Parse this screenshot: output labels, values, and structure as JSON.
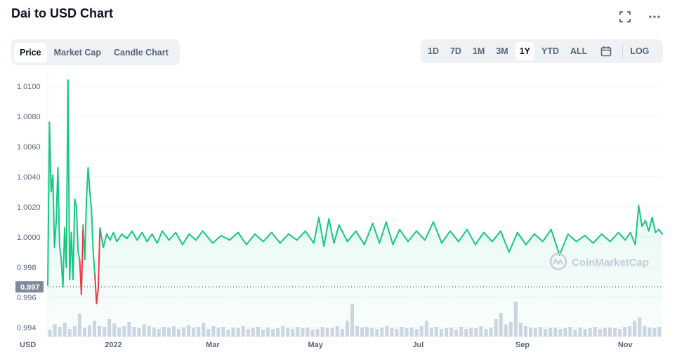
{
  "header": {
    "title": "Dai to USD Chart"
  },
  "icons": {
    "fullscreen": "fullscreen-icon",
    "more": "more-options-icon",
    "calendar": "calendar-icon",
    "watermark_logo": "coinmarketcap-logo-icon"
  },
  "tabs": [
    {
      "label": "Price",
      "active": true
    },
    {
      "label": "Market Cap",
      "active": false
    },
    {
      "label": "Candle Chart",
      "active": false
    }
  ],
  "ranges": [
    {
      "label": "1D",
      "active": false
    },
    {
      "label": "7D",
      "active": false
    },
    {
      "label": "1M",
      "active": false
    },
    {
      "label": "3M",
      "active": false
    },
    {
      "label": "1Y",
      "active": true
    },
    {
      "label": "YTD",
      "active": false
    },
    {
      "label": "ALL",
      "active": false
    }
  ],
  "log_label": "LOG",
  "watermark": "CoinMarketCap",
  "colors": {
    "up": "#16c784",
    "down": "#ea3943",
    "grid": "#eff2f5",
    "volume": "#cfd6e4",
    "current_label_bg": "#808a9d"
  },
  "chart_data": {
    "type": "area",
    "currency_label": "USD",
    "current_price_label": "0.997",
    "current_price": 0.9967,
    "ylim": [
      0.9934,
      1.0105
    ],
    "y_ticks": [
      {
        "value": 1.01,
        "label": "1.0100"
      },
      {
        "value": 1.008,
        "label": "1.0080"
      },
      {
        "value": 1.006,
        "label": "1.0060"
      },
      {
        "value": 1.004,
        "label": "1.0040"
      },
      {
        "value": 1.002,
        "label": "1.0020"
      },
      {
        "value": 1.0,
        "label": "1.0000"
      },
      {
        "value": 0.998,
        "label": "0.998"
      },
      {
        "value": 0.996,
        "label": "0.996"
      },
      {
        "value": 0.994,
        "label": "0.994"
      }
    ],
    "x_ticks": [
      {
        "label": "2022",
        "date": "2022-01-01"
      },
      {
        "label": "Mar",
        "date": "2022-03-01"
      },
      {
        "label": "May",
        "date": "2022-05-01"
      },
      {
        "label": "Jul",
        "date": "2022-07-01"
      },
      {
        "label": "Sep",
        "date": "2022-09-01"
      },
      {
        "label": "Nov",
        "date": "2022-11-01"
      }
    ],
    "x_range": [
      "2021-11-23",
      "2022-11-23"
    ],
    "series": [
      {
        "points": [
          [
            "2021-11-23",
            0.9968
          ],
          [
            "2021-11-24",
            1.0076
          ],
          [
            "2021-11-25",
            1.003
          ],
          [
            "2021-11-26",
            1.0041
          ],
          [
            "2021-11-27",
            0.9993
          ],
          [
            "2021-11-28",
            1.001
          ],
          [
            "2021-11-29",
            1.0046
          ],
          [
            "2021-11-30",
            0.9995
          ],
          [
            "2021-12-01",
            0.9985
          ],
          [
            "2021-12-02",
            0.9967
          ],
          [
            "2021-12-03",
            1.0006
          ],
          [
            "2021-12-04",
            0.998
          ],
          [
            "2021-12-05",
            1.0104
          ],
          [
            "2021-12-06",
            0.9972
          ],
          [
            "2021-12-07",
            1.0003
          ],
          [
            "2021-12-08",
            0.9972
          ],
          [
            "2021-12-09",
            1.0025
          ],
          [
            "2021-12-10",
            1.002
          ],
          [
            "2021-12-11",
            0.999
          ],
          [
            "2021-12-12",
            0.9985
          ],
          [
            "2021-12-13",
            0.9962
          ],
          [
            "2021-12-14",
            1.0008
          ],
          [
            "2021-12-15",
            0.9985
          ],
          [
            "2021-12-16",
            1.0025
          ],
          [
            "2021-12-17",
            1.0046
          ],
          [
            "2021-12-18",
            1.003
          ],
          [
            "2021-12-19",
            1.0018
          ],
          [
            "2021-12-20",
            0.999
          ],
          [
            "2021-12-21",
            0.9975
          ],
          [
            "2021-12-22",
            0.9956
          ],
          [
            "2021-12-23",
            0.9966
          ],
          [
            "2021-12-24",
            1.0006
          ],
          [
            "2021-12-26",
            0.9993
          ],
          [
            "2021-12-28",
            1.0002
          ],
          [
            "2021-12-30",
            0.9998
          ],
          [
            "2022-01-01",
            1.0003
          ],
          [
            "2022-01-03",
            0.9997
          ],
          [
            "2022-01-06",
            1.0002
          ],
          [
            "2022-01-09",
            0.9999
          ],
          [
            "2022-01-12",
            1.0004
          ],
          [
            "2022-01-15",
            0.9998
          ],
          [
            "2022-01-18",
            1.0003
          ],
          [
            "2022-01-21",
            0.9997
          ],
          [
            "2022-01-24",
            1.0002
          ],
          [
            "2022-01-27",
            0.9996
          ],
          [
            "2022-01-30",
            1.0004
          ],
          [
            "2022-02-03",
            0.9998
          ],
          [
            "2022-02-07",
            1.0003
          ],
          [
            "2022-02-11",
            0.9995
          ],
          [
            "2022-02-15",
            1.0002
          ],
          [
            "2022-02-19",
            0.9998
          ],
          [
            "2022-02-23",
            1.0004
          ],
          [
            "2022-03-01",
            0.9996
          ],
          [
            "2022-03-06",
            1.0001
          ],
          [
            "2022-03-11",
            0.9998
          ],
          [
            "2022-03-16",
            1.0003
          ],
          [
            "2022-03-21",
            0.9995
          ],
          [
            "2022-03-26",
            1.0002
          ],
          [
            "2022-03-31",
            0.9997
          ],
          [
            "2022-04-05",
            1.0003
          ],
          [
            "2022-04-10",
            0.9996
          ],
          [
            "2022-04-15",
            1.0002
          ],
          [
            "2022-04-20",
            0.9998
          ],
          [
            "2022-04-25",
            1.0004
          ],
          [
            "2022-04-30",
            0.9996
          ],
          [
            "2022-05-03",
            1.0013
          ],
          [
            "2022-05-06",
            0.9994
          ],
          [
            "2022-05-09",
            1.0012
          ],
          [
            "2022-05-12",
            0.9996
          ],
          [
            "2022-05-15",
            1.0008
          ],
          [
            "2022-05-20",
            0.9997
          ],
          [
            "2022-05-25",
            1.0004
          ],
          [
            "2022-05-30",
            0.9995
          ],
          [
            "2022-06-04",
            1.0009
          ],
          [
            "2022-06-08",
            0.9996
          ],
          [
            "2022-06-12",
            1.001
          ],
          [
            "2022-06-16",
            0.9995
          ],
          [
            "2022-06-20",
            1.0005
          ],
          [
            "2022-06-25",
            0.9997
          ],
          [
            "2022-06-30",
            1.0004
          ],
          [
            "2022-07-05",
            0.9998
          ],
          [
            "2022-07-10",
            1.001
          ],
          [
            "2022-07-15",
            0.9996
          ],
          [
            "2022-07-20",
            1.0004
          ],
          [
            "2022-07-25",
            0.9997
          ],
          [
            "2022-07-30",
            1.0005
          ],
          [
            "2022-08-04",
            0.9995
          ],
          [
            "2022-08-09",
            1.0003
          ],
          [
            "2022-08-14",
            0.9997
          ],
          [
            "2022-08-19",
            1.0004
          ],
          [
            "2022-08-24",
            0.999
          ],
          [
            "2022-08-29",
            1.0003
          ],
          [
            "2022-09-03",
            0.9995
          ],
          [
            "2022-09-08",
            1.0002
          ],
          [
            "2022-09-13",
            0.9997
          ],
          [
            "2022-09-18",
            1.0005
          ],
          [
            "2022-09-23",
            0.9988
          ],
          [
            "2022-09-28",
            1.0002
          ],
          [
            "2022-10-03",
            0.9997
          ],
          [
            "2022-10-08",
            1.0001
          ],
          [
            "2022-10-13",
            0.9996
          ],
          [
            "2022-10-18",
            1.0002
          ],
          [
            "2022-10-23",
            0.9997
          ],
          [
            "2022-10-28",
            1.0003
          ],
          [
            "2022-11-01",
            0.9998
          ],
          [
            "2022-11-04",
            1.0003
          ],
          [
            "2022-11-07",
            0.9995
          ],
          [
            "2022-11-09",
            1.0021
          ],
          [
            "2022-11-11",
            1.0007
          ],
          [
            "2022-11-13",
            1.0011
          ],
          [
            "2022-11-15",
            1.0004
          ],
          [
            "2022-11-17",
            1.0013
          ],
          [
            "2022-11-19",
            1.0003
          ],
          [
            "2022-11-21",
            1.0005
          ],
          [
            "2022-11-23",
            1.0002
          ]
        ]
      }
    ],
    "volume": {
      "relative_values": [
        0.2,
        0.35,
        0.28,
        0.4,
        0.22,
        0.3,
        0.65,
        0.25,
        0.32,
        0.45,
        0.3,
        0.28,
        0.5,
        0.38,
        0.26,
        0.3,
        0.42,
        0.28,
        0.24,
        0.35,
        0.3,
        0.26,
        0.22,
        0.28,
        0.25,
        0.3,
        0.22,
        0.27,
        0.33,
        0.25,
        0.28,
        0.4,
        0.22,
        0.3,
        0.25,
        0.28,
        0.2,
        0.26,
        0.24,
        0.3,
        0.22,
        0.25,
        0.28,
        0.2,
        0.26,
        0.22,
        0.24,
        0.3,
        0.25,
        0.22,
        0.28,
        0.24,
        0.26,
        0.2,
        0.22,
        0.28,
        0.24,
        0.25,
        0.3,
        0.22,
        0.45,
        0.92,
        0.3,
        0.26,
        0.28,
        0.24,
        0.22,
        0.26,
        0.3,
        0.25,
        0.22,
        0.28,
        0.24,
        0.26,
        0.22,
        0.3,
        0.45,
        0.25,
        0.28,
        0.22,
        0.24,
        0.26,
        0.2,
        0.28,
        0.22,
        0.25,
        0.24,
        0.3,
        0.22,
        0.26,
        0.5,
        0.68,
        0.35,
        0.42,
        1.0,
        0.4,
        0.3,
        0.26,
        0.24,
        0.28,
        0.22,
        0.25,
        0.26,
        0.22,
        0.24,
        0.28,
        0.2,
        0.26,
        0.22,
        0.24,
        0.28,
        0.22,
        0.25,
        0.26,
        0.24,
        0.22,
        0.28,
        0.3,
        0.45,
        0.55,
        0.3,
        0.26,
        0.24,
        0.28
      ]
    }
  }
}
